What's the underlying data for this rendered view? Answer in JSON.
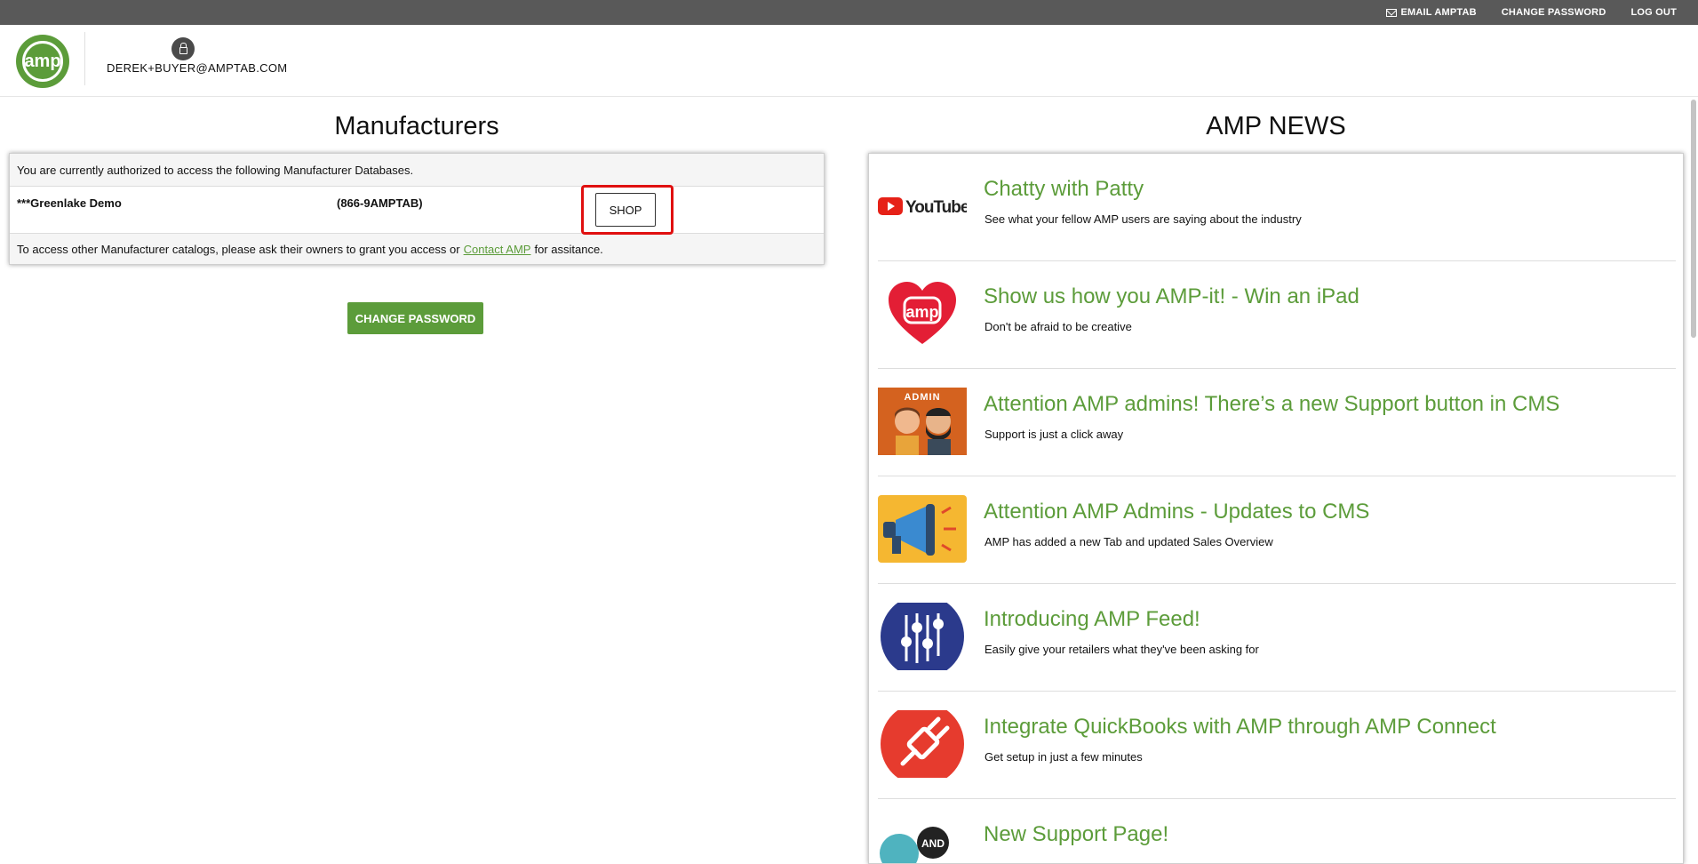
{
  "topbar": {
    "email_label": "EMAIL AMPTAB",
    "change_password_label": "CHANGE PASSWORD",
    "logout_label": "LOG OUT"
  },
  "header": {
    "logo_text": "amp",
    "user_email": "DEREK+BUYER@AMPTAB.COM"
  },
  "manufacturers": {
    "title": "Manufacturers",
    "intro": "You are currently authorized to access the following Manufacturer Databases.",
    "rows": [
      {
        "name": "***Greenlake Demo",
        "phone": "(866-9AMPTAB)",
        "shop_label": "SHOP"
      }
    ],
    "footer_before": "To access other Manufacturer catalogs, please ask their owners to grant you access or",
    "footer_link": "Contact AMP",
    "footer_after": "for assitance.",
    "change_password_button": "CHANGE PASSWORD"
  },
  "news": {
    "title": "AMP NEWS",
    "items": [
      {
        "title": "Chatty with Patty",
        "subtitle": "See what your fellow AMP users are saying about the industry",
        "thumb": "youtube-logo",
        "thumb_text": "YouTube"
      },
      {
        "title": "Show us how you AMP-it! - Win an iPad",
        "subtitle": "Don't be afraid to be creative",
        "thumb": "amp-heart-icon",
        "thumb_text": "amp"
      },
      {
        "title": "Attention AMP admins! There’s a new Support button in CMS",
        "subtitle": "Support is just a click away",
        "thumb": "admin-people-icon",
        "thumb_text": "ADMIN"
      },
      {
        "title": "Attention AMP Admins - Updates to CMS",
        "subtitle": "AMP has added a new Tab and updated Sales Overview",
        "thumb": "megaphone-icon"
      },
      {
        "title": "Introducing AMP Feed!",
        "subtitle": "Easily give your retailers what they've been asking for",
        "thumb": "sliders-icon"
      },
      {
        "title": "Integrate QuickBooks with AMP through AMP Connect",
        "subtitle": "Get setup in just a few minutes",
        "thumb": "plug-icon"
      },
      {
        "title": "New Support Page!",
        "subtitle": "",
        "thumb": "help-badge-icon",
        "thumb_text": "AND"
      }
    ]
  },
  "colors": {
    "brand_green": "#5c9c3a",
    "topbar": "#595959",
    "highlight_red": "#e01010"
  }
}
